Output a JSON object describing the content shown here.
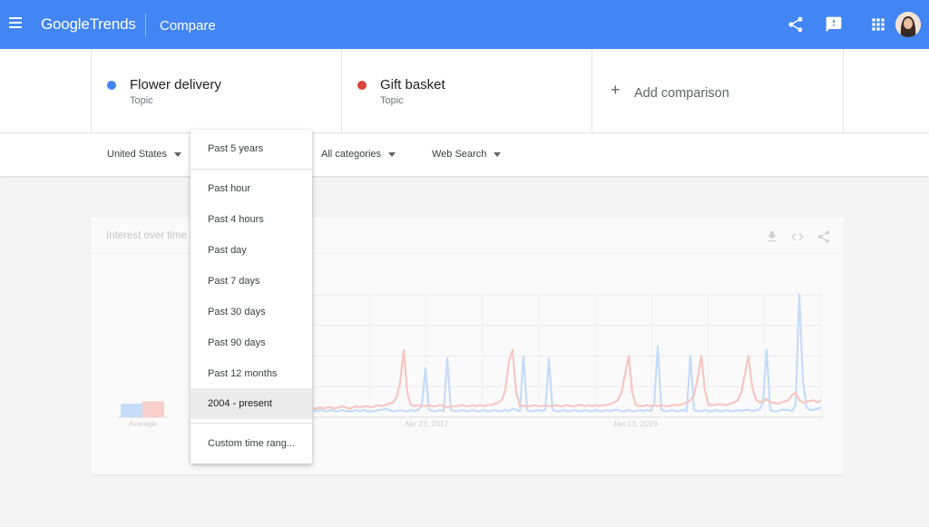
{
  "header": {
    "logo_google": "Google",
    "logo_trends": "Trends",
    "page_title": "Compare"
  },
  "terms": [
    {
      "name": "Flower delivery",
      "type": "Topic",
      "color": "#4285f4"
    },
    {
      "name": "Gift basket",
      "type": "Topic",
      "color": "#db4437"
    }
  ],
  "add_comparison": "Add comparison",
  "filters": {
    "region": "United States",
    "category": "All categories",
    "search_type": "Web Search"
  },
  "card": {
    "title": "Interest over time"
  },
  "time_menu": {
    "current": "Past 5 years",
    "options": [
      "Past hour",
      "Past 4 hours",
      "Past day",
      "Past 7 days",
      "Past 30 days",
      "Past 90 days",
      "Past 12 months",
      "2004 - present"
    ],
    "selected_option": "2004 - present",
    "custom": "Custom time rang..."
  },
  "chart_data": {
    "type": "line",
    "average_label": "Average",
    "x_tick_labels": [
      "Apr 23, 2017",
      "Jan 13, 2019"
    ],
    "averages": [
      {
        "series": "Flower delivery",
        "value": 11
      },
      {
        "series": "Gift basket",
        "value": 13
      }
    ],
    "ylim": [
      0,
      100
    ],
    "grid": true,
    "series": [
      {
        "name": "Flower delivery",
        "color": "#4285f4",
        "values": [
          5,
          5,
          6,
          5,
          5,
          6,
          5,
          5,
          6,
          5,
          5,
          5,
          6,
          5,
          6,
          5,
          5,
          5,
          6,
          6,
          7,
          6,
          5,
          5,
          6,
          5,
          5,
          6,
          5,
          6,
          10,
          40,
          6,
          5,
          5,
          6,
          5,
          48,
          6,
          5,
          5,
          6,
          5,
          5,
          6,
          5,
          5,
          6,
          5,
          5,
          6,
          5,
          5,
          6,
          5,
          7,
          6,
          5,
          50,
          6,
          5,
          5,
          6,
          5,
          6,
          48,
          6,
          5,
          5,
          6,
          5,
          5,
          6,
          5,
          5,
          6,
          5,
          5,
          6,
          5,
          5,
          6,
          5,
          6,
          6,
          5,
          5,
          6,
          5,
          5,
          6,
          5,
          6,
          5,
          10,
          58,
          6,
          5,
          5,
          6,
          5,
          5,
          6,
          5,
          50,
          6,
          5,
          5,
          6,
          5,
          5,
          6,
          5,
          5,
          6,
          5,
          5,
          6,
          5,
          6,
          6,
          5,
          6,
          6,
          12,
          55,
          6,
          5,
          5,
          6,
          6,
          6,
          5,
          10,
          100,
          30,
          8,
          6,
          6,
          7,
          8
        ]
      },
      {
        "name": "Gift basket",
        "color": "#db4437",
        "values": [
          7,
          7,
          8,
          7,
          8,
          8,
          7,
          8,
          9,
          8,
          7,
          8,
          9,
          8,
          9,
          9,
          8,
          9,
          10,
          9,
          10,
          11,
          12,
          16,
          28,
          55,
          20,
          10,
          9,
          10,
          9,
          9,
          10,
          9,
          9,
          10,
          9,
          8,
          9,
          9,
          9,
          10,
          9,
          9,
          10,
          9,
          10,
          9,
          10,
          10,
          11,
          12,
          14,
          22,
          46,
          55,
          20,
          10,
          9,
          9,
          9,
          10,
          9,
          9,
          10,
          9,
          9,
          10,
          9,
          9,
          10,
          9,
          9,
          10,
          10,
          9,
          10,
          9,
          10,
          9,
          10,
          10,
          11,
          12,
          14,
          20,
          35,
          50,
          20,
          10,
          9,
          9,
          10,
          9,
          10,
          9,
          10,
          9,
          9,
          10,
          10,
          10,
          11,
          12,
          14,
          18,
          32,
          50,
          22,
          10,
          10,
          10,
          11,
          10,
          10,
          11,
          12,
          14,
          20,
          35,
          50,
          25,
          15,
          12,
          13,
          15,
          12,
          12,
          11,
          12,
          13,
          14,
          18,
          20,
          14,
          12,
          13,
          13,
          14,
          12,
          14
        ]
      }
    ]
  }
}
